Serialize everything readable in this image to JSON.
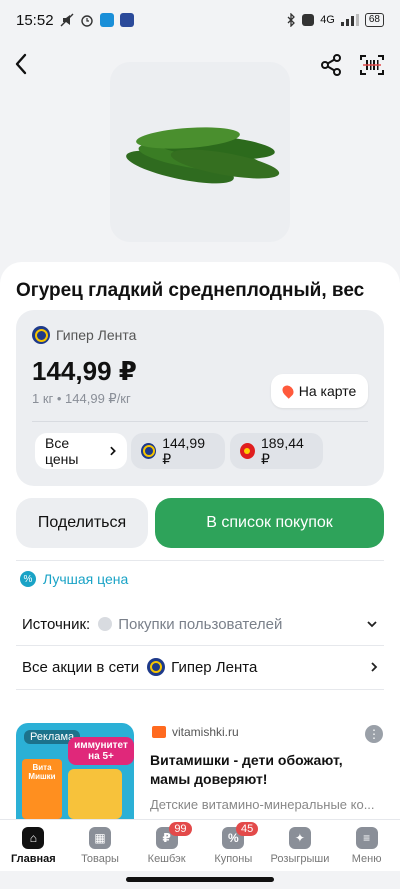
{
  "status_bar": {
    "time": "15:52",
    "network": "4G",
    "battery": "68"
  },
  "product": {
    "title": "Огурец гладкий среднеплодный, вес",
    "image_icon": "cucumber-image"
  },
  "store_card": {
    "store_name": "Гипер Лента",
    "price": "144,99 ₽",
    "unit_price": "1 кг • 144,99 ₽/кг",
    "map_button": "На карте",
    "all_prices": "Все цены",
    "price_chips": [
      {
        "price": "144,99 ₽"
      },
      {
        "price": "189,44 ₽"
      }
    ]
  },
  "actions": {
    "share": "Поделиться",
    "add_to_list": "В список покупок"
  },
  "info": {
    "best_price": "Лучшая цена",
    "source_label": "Источник:",
    "source_value": "Покупки пользователей",
    "all_promos": "Все акции в сети",
    "all_promos_store": "Гипер Лента"
  },
  "ad": {
    "tag": "Реклама",
    "badge": "иммунитет на 5+",
    "pack_text": "Вита Мишки",
    "source": "vitamishki.ru",
    "title": "Витамишки - дети обожают, мамы доверяют!",
    "description": "Детские витамино-минеральные ко..."
  },
  "bottom_nav": [
    {
      "label": "Главная",
      "icon": "home-icon",
      "active": true
    },
    {
      "label": "Товары",
      "icon": "grid-icon"
    },
    {
      "label": "Кешбэк",
      "icon": "cashback-icon",
      "badge": "99"
    },
    {
      "label": "Купоны",
      "icon": "coupon-icon",
      "badge": "45"
    },
    {
      "label": "Розыгрыши",
      "icon": "gift-icon"
    },
    {
      "label": "Меню",
      "icon": "menu-icon"
    }
  ],
  "colors": {
    "accent_green": "#2ea35a",
    "best_price_blue": "#1aa3c6",
    "badge_red": "#e34a4a"
  }
}
